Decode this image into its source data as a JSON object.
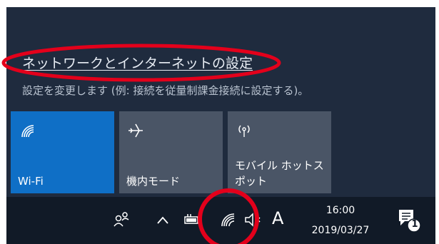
{
  "network_settings": {
    "link_label": "ネットワークとインターネットの設定",
    "description": "設定を変更します (例: 接続を従量制課金接続に設定する)。"
  },
  "quick_actions": [
    {
      "label": "Wi-Fi",
      "icon": "wifi-icon",
      "active": true
    },
    {
      "label": "機内モード",
      "icon": "airplane-icon",
      "active": false
    },
    {
      "label": "モバイル ホットス\nポット",
      "icon": "mobile-hotspot-icon",
      "active": false
    }
  ],
  "taskbar": {
    "ime_label": "A",
    "time": "16:00",
    "date": "2019/03/27",
    "notification_count": "1",
    "icons": [
      "people-icon",
      "chevron-up-icon",
      "battery-icon",
      "wifi-icon",
      "volume-muted-icon",
      "notification-center-icon"
    ]
  },
  "colors": {
    "panel_bg": "#1f2b3e",
    "taskbar_bg": "#111a27",
    "tile_active": "#0f6fc6",
    "tile_inactive": "#4a5566",
    "annotation_red": "#e3001b"
  }
}
